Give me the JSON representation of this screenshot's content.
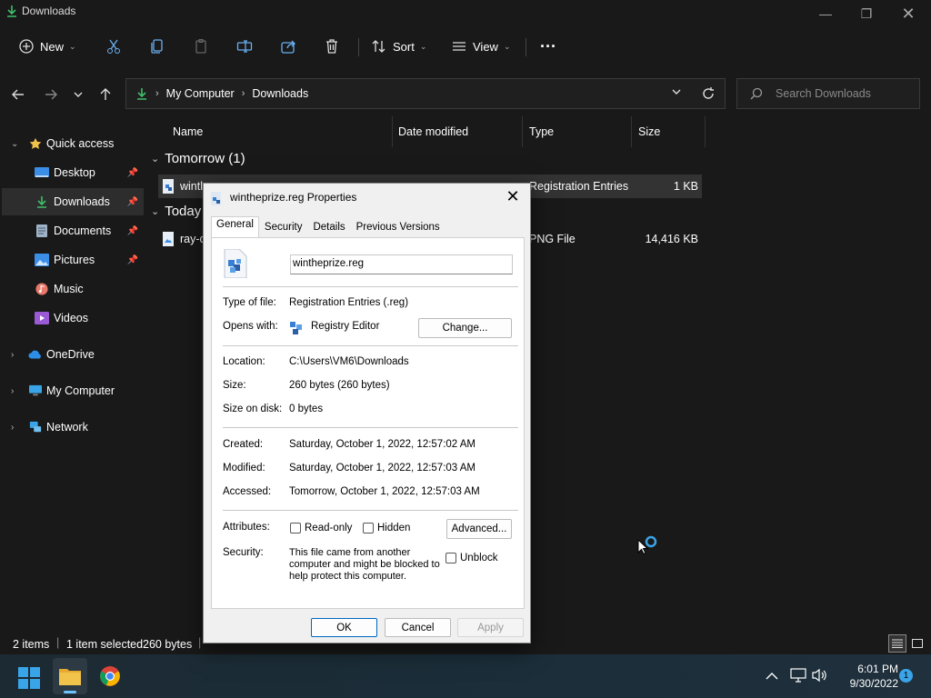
{
  "window": {
    "title": "Downloads"
  },
  "toolbar": {
    "new_label": "New",
    "sort_label": "Sort",
    "view_label": "View",
    "more_label": "…"
  },
  "address": {
    "crumbs": [
      "My Computer",
      "Downloads"
    ],
    "search_placeholder": "Search Downloads"
  },
  "nav": {
    "quick_access": "Quick access",
    "items": [
      "Desktop",
      "Downloads",
      "Documents",
      "Pictures",
      "Music",
      "Videos"
    ],
    "onedrive": "OneDrive",
    "my_computer": "My Computer",
    "network": "Network"
  },
  "columns": {
    "name": "Name",
    "date": "Date modified",
    "type": "Type",
    "size": "Size"
  },
  "groups": {
    "tomorrow": "Tomorrow (1)",
    "today": "Today"
  },
  "files": [
    {
      "name": "wintl",
      "type": "Registration Entries",
      "size": "1 KB"
    },
    {
      "name": "ray-c",
      "type": "PNG File",
      "size": "14,416 KB"
    }
  ],
  "status": {
    "items": "2 items",
    "selected": "1 item selected",
    "size": "260 bytes"
  },
  "taskbar": {
    "time": "6:01 PM",
    "date": "9/30/2022",
    "badge": "1"
  },
  "dialog": {
    "title": "wintheprize.reg Properties",
    "tabs": [
      "General",
      "Security",
      "Details",
      "Previous Versions"
    ],
    "filename": "wintheprize.reg",
    "type_label": "Type of file:",
    "type_value": "Registration Entries (.reg)",
    "opens_label": "Opens with:",
    "opens_value": "Registry Editor",
    "change_label": "Change...",
    "location_label": "Location:",
    "location_value": "C:\\Users\\VM6\\Downloads",
    "size_label": "Size:",
    "size_value": "260 bytes (260 bytes)",
    "disk_label": "Size on disk:",
    "disk_value": "0 bytes",
    "created_label": "Created:",
    "created_value": "Saturday, October 1, 2022, 12:57:02 AM",
    "modified_label": "Modified:",
    "modified_value": "Saturday, October 1, 2022, 12:57:03 AM",
    "accessed_label": "Accessed:",
    "accessed_value": "Tomorrow, October 1, 2022, 12:57:03 AM",
    "attributes_label": "Attributes:",
    "readonly_label": "Read-only",
    "hidden_label": "Hidden",
    "advanced_label": "Advanced...",
    "security_label": "Security:",
    "security_line1": "This file came from another",
    "security_line2": "computer and might be blocked to",
    "security_line3": "help protect this computer.",
    "unblock_label": "Unblock",
    "ok_label": "OK",
    "cancel_label": "Cancel",
    "apply_label": "Apply"
  },
  "colors": {
    "accent": "#0067c0",
    "download_green": "#3fbf6a",
    "folder_yellow": "#f2c34b"
  }
}
